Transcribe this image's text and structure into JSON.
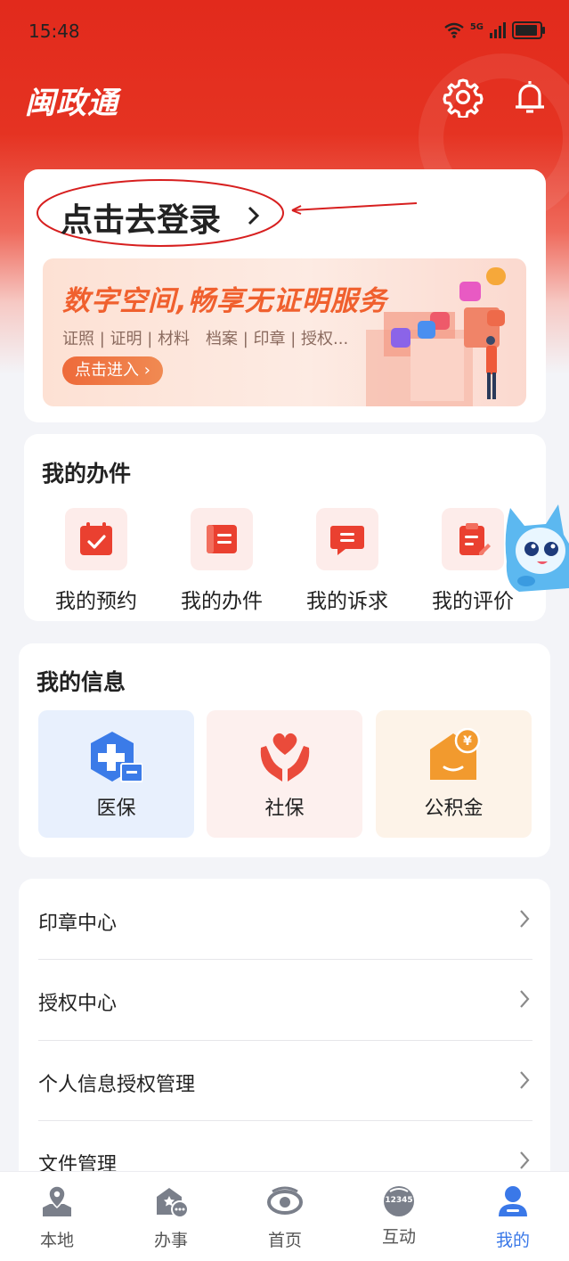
{
  "status_bar": {
    "time": "15:48",
    "network": "5G"
  },
  "header": {
    "logo_text": "闽政通",
    "settings_icon": "gear-icon",
    "notification_icon": "bell-icon"
  },
  "login_card": {
    "login_text": "点击去登录",
    "banner": {
      "title": "数字空间,畅享无证明服务",
      "subtitle": "证照 | 证明 | 材料　档案 | 印章 | 授权...",
      "button": "点击进入 ›"
    }
  },
  "my_tasks": {
    "title": "我的办件",
    "items": [
      {
        "label": "我的预约",
        "icon": "calendar-icon"
      },
      {
        "label": "我的办件",
        "icon": "document-icon"
      },
      {
        "label": "我的诉求",
        "icon": "chat-icon"
      },
      {
        "label": "我的评价",
        "icon": "clipboard-edit-icon"
      }
    ]
  },
  "my_info": {
    "title": "我的信息",
    "tiles": [
      {
        "label": "医保",
        "icon": "medical-insurance-icon",
        "bg": "#e8f0fd",
        "color": "#3b7be8"
      },
      {
        "label": "社保",
        "icon": "social-security-icon",
        "bg": "#fdf0ee",
        "color": "#ea4b3b"
      },
      {
        "label": "公积金",
        "icon": "housing-fund-icon",
        "bg": "#fdf3e8",
        "color": "#f29a2e"
      }
    ]
  },
  "menu_list": [
    {
      "label": "印章中心"
    },
    {
      "label": "授权中心"
    },
    {
      "label": "个人信息授权管理"
    },
    {
      "label": "文件管理"
    }
  ],
  "tab_bar": {
    "tabs": [
      {
        "label": "本地",
        "icon": "location-icon",
        "active": false
      },
      {
        "label": "办事",
        "icon": "service-hall-icon",
        "active": false
      },
      {
        "label": "首页",
        "icon": "home-eye-icon",
        "active": false
      },
      {
        "label": "互动",
        "icon": "hotline-12345-icon",
        "active": false,
        "badge": "12345"
      },
      {
        "label": "我的",
        "icon": "user-icon",
        "active": true
      }
    ]
  },
  "colors": {
    "brand_red": "#e22a1c",
    "active_blue": "#3a78e8"
  }
}
